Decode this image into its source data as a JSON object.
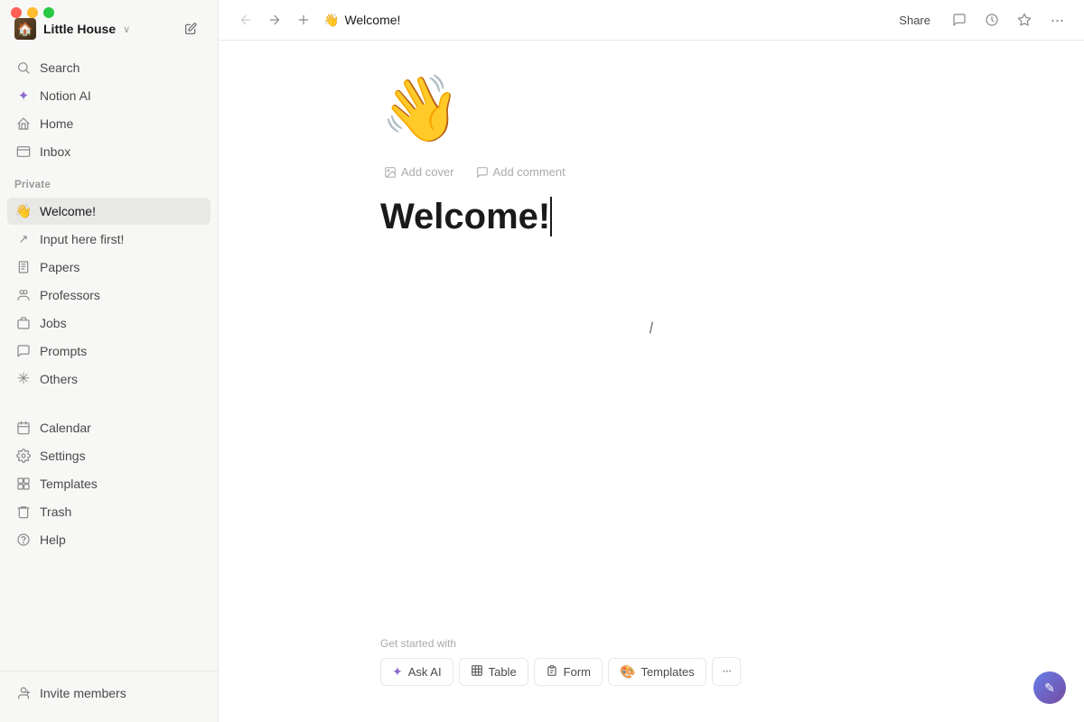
{
  "app": {
    "title": "Little House",
    "workspace_initial": "🏠"
  },
  "topbar": {
    "title": "Welcome!",
    "emoji": "👋",
    "share_label": "Share"
  },
  "sidebar": {
    "search_label": "Search",
    "notion_ai_label": "Notion AI",
    "home_label": "Home",
    "inbox_label": "Inbox",
    "private_label": "Private",
    "pages": [
      {
        "id": "welcome",
        "label": "Welcome!",
        "emoji": "👋",
        "active": true
      },
      {
        "id": "input-here-first",
        "label": "Input here first!",
        "emoji": "↗"
      },
      {
        "id": "papers",
        "label": "Papers",
        "emoji": "📋"
      },
      {
        "id": "professors",
        "label": "Professors",
        "emoji": "👥"
      },
      {
        "id": "jobs",
        "label": "Jobs",
        "emoji": "💼"
      },
      {
        "id": "prompts",
        "label": "Prompts",
        "emoji": "💬"
      },
      {
        "id": "others",
        "label": "Others",
        "emoji": "✳"
      }
    ],
    "calendar_label": "Calendar",
    "settings_label": "Settings",
    "templates_label": "Templates",
    "trash_label": "Trash",
    "help_label": "Help",
    "invite_label": "Invite members"
  },
  "page": {
    "emoji": "👋",
    "title": "Welcome!",
    "add_cover_label": "Add cover",
    "add_comment_label": "Add comment"
  },
  "get_started": {
    "label": "Get started with",
    "buttons": [
      {
        "id": "ask-ai",
        "label": "Ask AI",
        "icon": "✦"
      },
      {
        "id": "table",
        "label": "Table",
        "icon": "⊞"
      },
      {
        "id": "form",
        "label": "Form",
        "icon": "☰"
      },
      {
        "id": "templates",
        "label": "Templates",
        "icon": "🎨"
      }
    ],
    "more_icon": "···"
  }
}
